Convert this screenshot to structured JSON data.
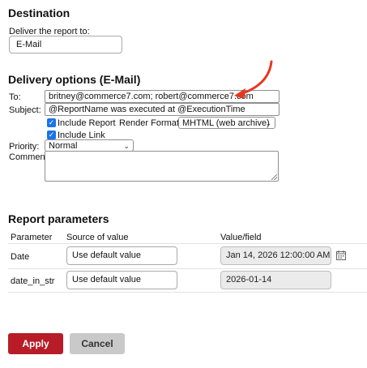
{
  "destination": {
    "heading": "Destination",
    "deliver_label": "Deliver the report to:",
    "deliver_value": "E-Mail"
  },
  "delivery": {
    "heading": "Delivery options (E-Mail)",
    "to_label": "To:",
    "to_value": "britney@commerce7.com; robert@commerce7.com",
    "subject_label": "Subject:",
    "subject_value": "@ReportName was executed at @ExecutionTime",
    "include_report_label": "Include Report",
    "include_report_checked": true,
    "render_format_label": "Render Format:",
    "render_format_value": "MHTML (web archive)",
    "include_link_label": "Include Link",
    "include_link_checked": true,
    "priority_label": "Priority:",
    "priority_value": "Normal",
    "comment_label": "Comment:",
    "comment_value": ""
  },
  "parameters": {
    "heading": "Report parameters",
    "columns": [
      "Parameter",
      "Source of value",
      "Value/field"
    ],
    "rows": [
      {
        "name": "Date",
        "source": "Use default value",
        "value": "Jan 14, 2026 12:00:00 AM",
        "has_calendar": true
      },
      {
        "name": "date_in_str",
        "source": "Use default value",
        "value": "2026-01-14",
        "has_calendar": false
      }
    ]
  },
  "actions": {
    "apply_label": "Apply",
    "cancel_label": "Cancel"
  },
  "colors": {
    "apply_bg": "#b71c27",
    "annotation_arrow": "#e8361e",
    "checkbox": "#1a73e8"
  },
  "icons": {
    "calendar": "calendar-icon",
    "annotation": "red-arrow-annotation",
    "checkmark": "checkmark-icon"
  }
}
